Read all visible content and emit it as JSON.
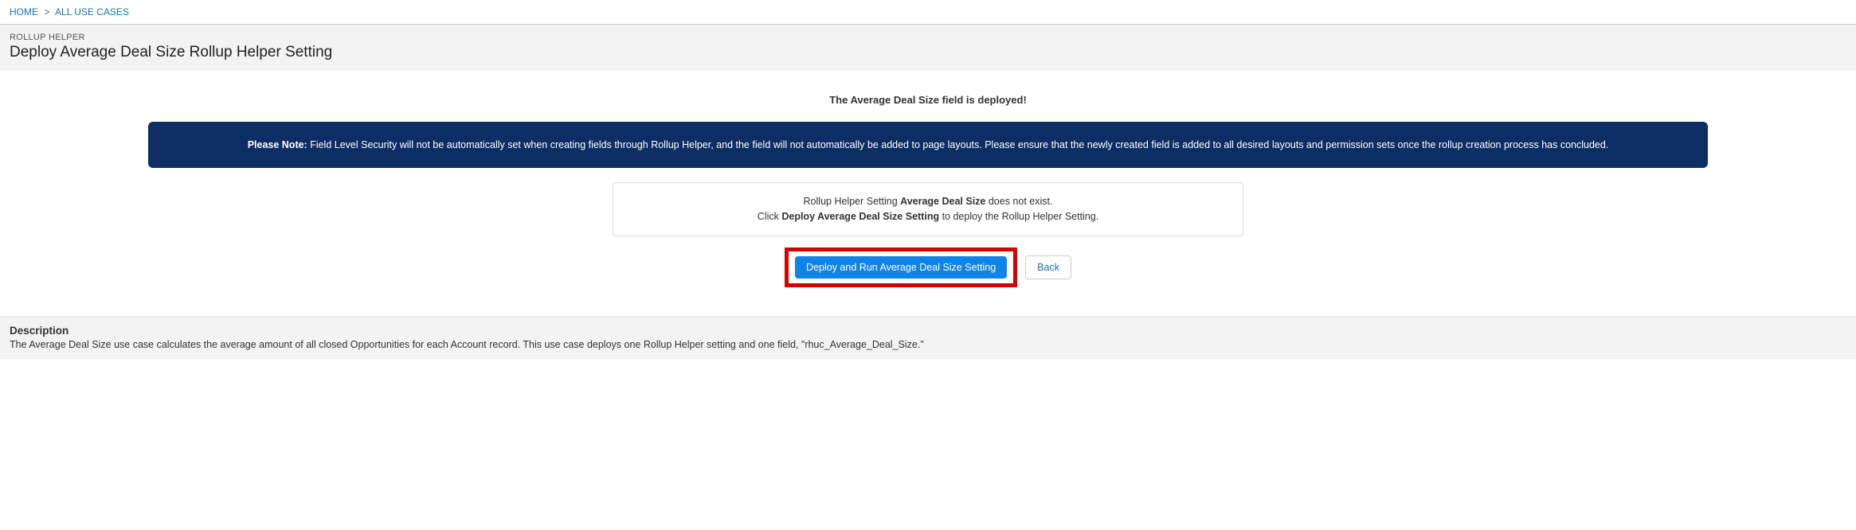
{
  "breadcrumb": {
    "home": "HOME",
    "sep": ">",
    "all_use_cases": "ALL USE CASES"
  },
  "header": {
    "app_label": "ROLLUP HELPER",
    "page_title": "Deploy Average Deal Size Rollup Helper Setting"
  },
  "content": {
    "deployed_msg": "The Average Deal Size field is deployed!",
    "note_prefix": "Please Note:",
    "note_body": " Field Level Security will not be automatically set when creating fields through Rollup Helper, and the field will not automatically be added to page layouts. Please ensure that the newly created field is added to all desired layouts and permission sets once the rollup creation process has concluded.",
    "msg_line1_pre": "Rollup Helper Setting ",
    "msg_line1_bold": "Average Deal Size",
    "msg_line1_post": " does not exist.",
    "msg_line2_pre": "Click ",
    "msg_line2_bold": "Deploy Average Deal Size Setting",
    "msg_line2_post": " to deploy the Rollup Helper Setting."
  },
  "actions": {
    "deploy_label": "Deploy and Run Average Deal Size Setting",
    "back_label": "Back"
  },
  "description": {
    "title": "Description",
    "body": "The Average Deal Size use case calculates the average amount of all closed Opportunities for each Account record. This use case deploys one Rollup Helper setting and one field, \"rhuc_Average_Deal_Size.\""
  }
}
